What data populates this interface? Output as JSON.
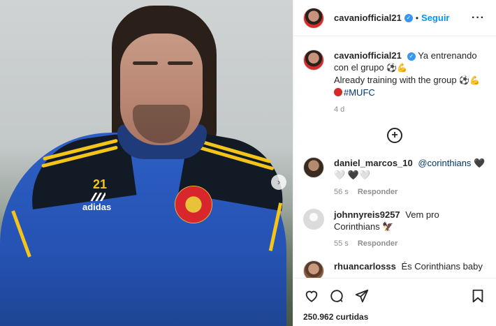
{
  "post": {
    "image_alt": "Photo",
    "jersey_number": "21",
    "jersey_brand": "adidas"
  },
  "header": {
    "username": "cavaniofficial21",
    "verified_mark": "✓",
    "separator": "•",
    "follow_label": "Seguir",
    "more_glyph": "···"
  },
  "caption": {
    "username": "cavaniofficial21",
    "verified_mark": "✓",
    "line1": "Ya entrenando con el grupo",
    "line1_emojis": "⚽💪",
    "line2": "Already training with the group",
    "line2_emojis": "⚽💪",
    "hashtag": "#MUFC",
    "age": "4 d"
  },
  "load_more_glyph": "+",
  "comments": [
    {
      "username": "daniel_marcos_10",
      "mention": "@corinthians",
      "text": "🖤🤍 🖤🤍",
      "age": "56 s",
      "reply_label": "Responder"
    },
    {
      "username": "johnnyreis9257",
      "text": "Vem pro Corinthians 🦅",
      "age": "55 s",
      "reply_label": "Responder"
    },
    {
      "username": "rhuancarlosss",
      "text": "És Corinthians baby"
    }
  ],
  "actions": {
    "icons": [
      "heart-icon",
      "comment-icon",
      "share-icon",
      "bookmark-icon"
    ],
    "likes": "250.962 curtidas"
  },
  "colors": {
    "accent": "#0095f6",
    "verified": "#3897f0",
    "muted": "#8e8e8e",
    "text": "#262626"
  }
}
